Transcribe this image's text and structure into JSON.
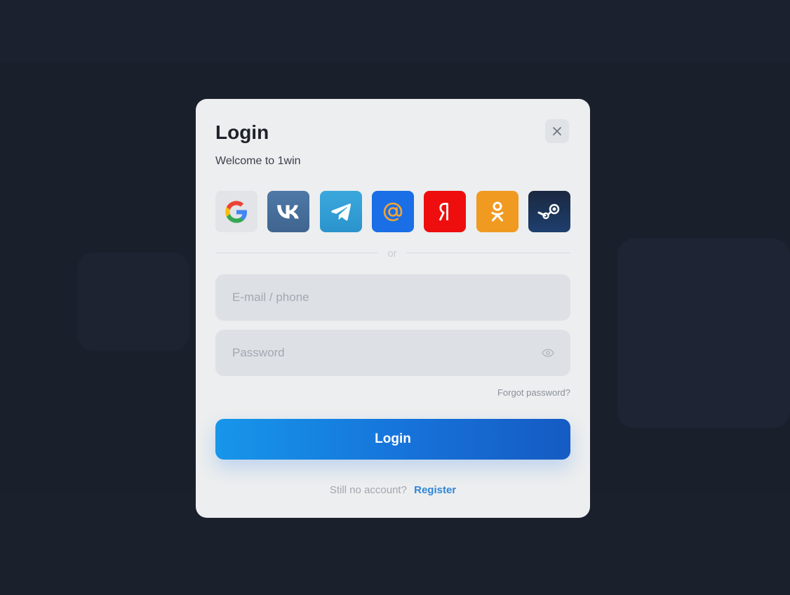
{
  "modal": {
    "title": "Login",
    "subtitle": "Welcome to 1win",
    "close_icon": "close-icon",
    "social_buttons": [
      {
        "service": "Google",
        "icon": "google-icon",
        "color": "#e2e4e8"
      },
      {
        "service": "VK",
        "icon": "vk-icon",
        "color": "#4a71a0"
      },
      {
        "service": "Telegram",
        "icon": "telegram-icon",
        "color": "#33a0d6"
      },
      {
        "service": "Mail.ru",
        "icon": "mail-at-icon",
        "color": "#1a6ee6"
      },
      {
        "service": "Yandex",
        "icon": "yandex-icon",
        "color": "#ee0e0e"
      },
      {
        "service": "Odnoklassniki",
        "icon": "odnoklassniki-icon",
        "color": "#f19a21"
      },
      {
        "service": "Steam",
        "icon": "steam-icon",
        "color": "#1b2f52"
      }
    ],
    "divider_text": "or",
    "email_placeholder": "E-mail / phone",
    "email_value": "",
    "password_placeholder": "Password",
    "password_value": "",
    "password_toggle_icon": "eye-icon",
    "forgot_password": "Forgot password?",
    "login_button": "Login",
    "no_account_text": "Still no account?",
    "register_link": "Register"
  },
  "colors": {
    "page_background": "#1a1f2c",
    "modal_background": "#eceeef",
    "accent": "#1672d9",
    "link": "#2f86d9"
  }
}
